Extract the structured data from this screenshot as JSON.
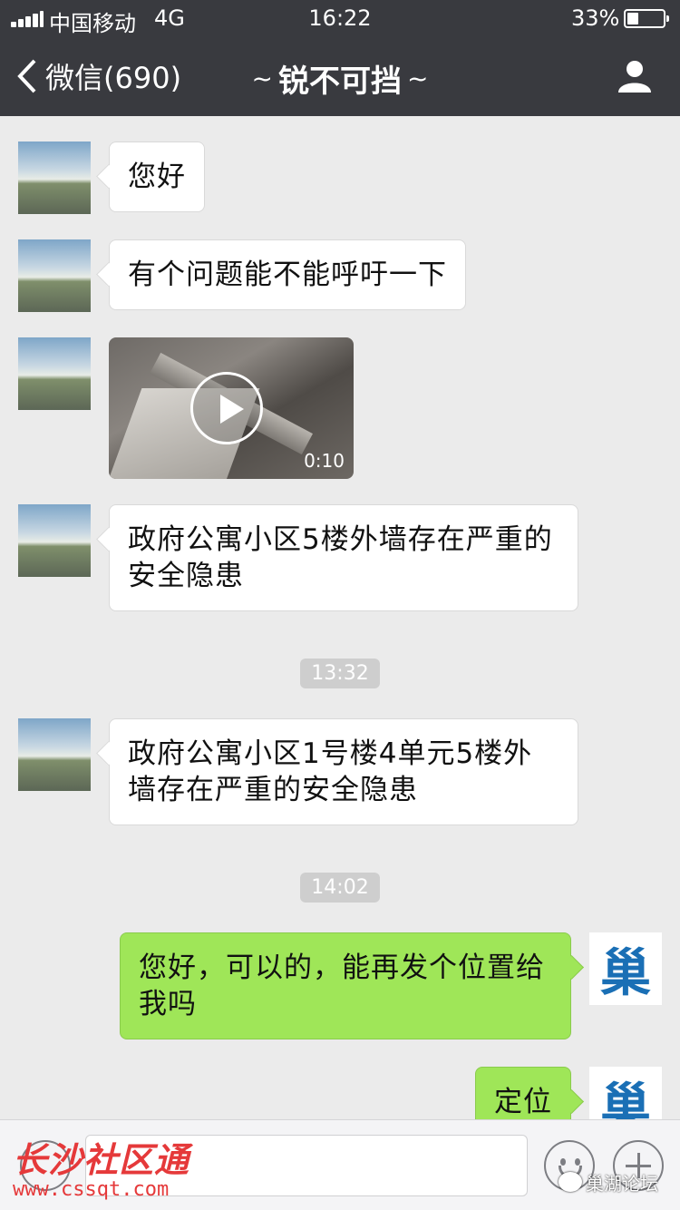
{
  "status_bar": {
    "carrier": "中国移动",
    "network": "4G",
    "time": "16:22",
    "battery": "33%",
    "battery_level": 0.33
  },
  "nav": {
    "back_label": "微信(690)",
    "title": "锐不可挡",
    "ornament_left": "~",
    "ornament_right": "~",
    "back_icon": "chevron-left-icon",
    "profile_icon": "person-icon"
  },
  "messages": [
    {
      "side": "in",
      "text": "您好"
    },
    {
      "side": "in",
      "text": "有个问题能不能呼吁一下"
    },
    {
      "side": "in",
      "type": "video",
      "duration": "0:10"
    },
    {
      "side": "in",
      "text": "政府公寓小区5楼外墙存在严重的安全隐患"
    },
    {
      "type": "timestamp",
      "text": "13:32"
    },
    {
      "side": "in",
      "text": "政府公寓小区1号楼4单元5楼外墙存在严重的安全隐患"
    },
    {
      "type": "timestamp",
      "text": "14:02"
    },
    {
      "side": "out",
      "text": "您好，可以的，能再发个位置给我吗"
    },
    {
      "side": "out",
      "text": "定位"
    }
  ],
  "avatars": {
    "self_glyph": "巢"
  },
  "watermarks": {
    "left_title": "长沙社区通",
    "left_url": "www.cssqt.com",
    "right_text": "巢湖论坛"
  },
  "colors": {
    "navbar": "#393a3f",
    "chat_bg": "#ebebeb",
    "outgoing_bubble": "#9fe658",
    "incoming_bubble": "#ffffff"
  }
}
